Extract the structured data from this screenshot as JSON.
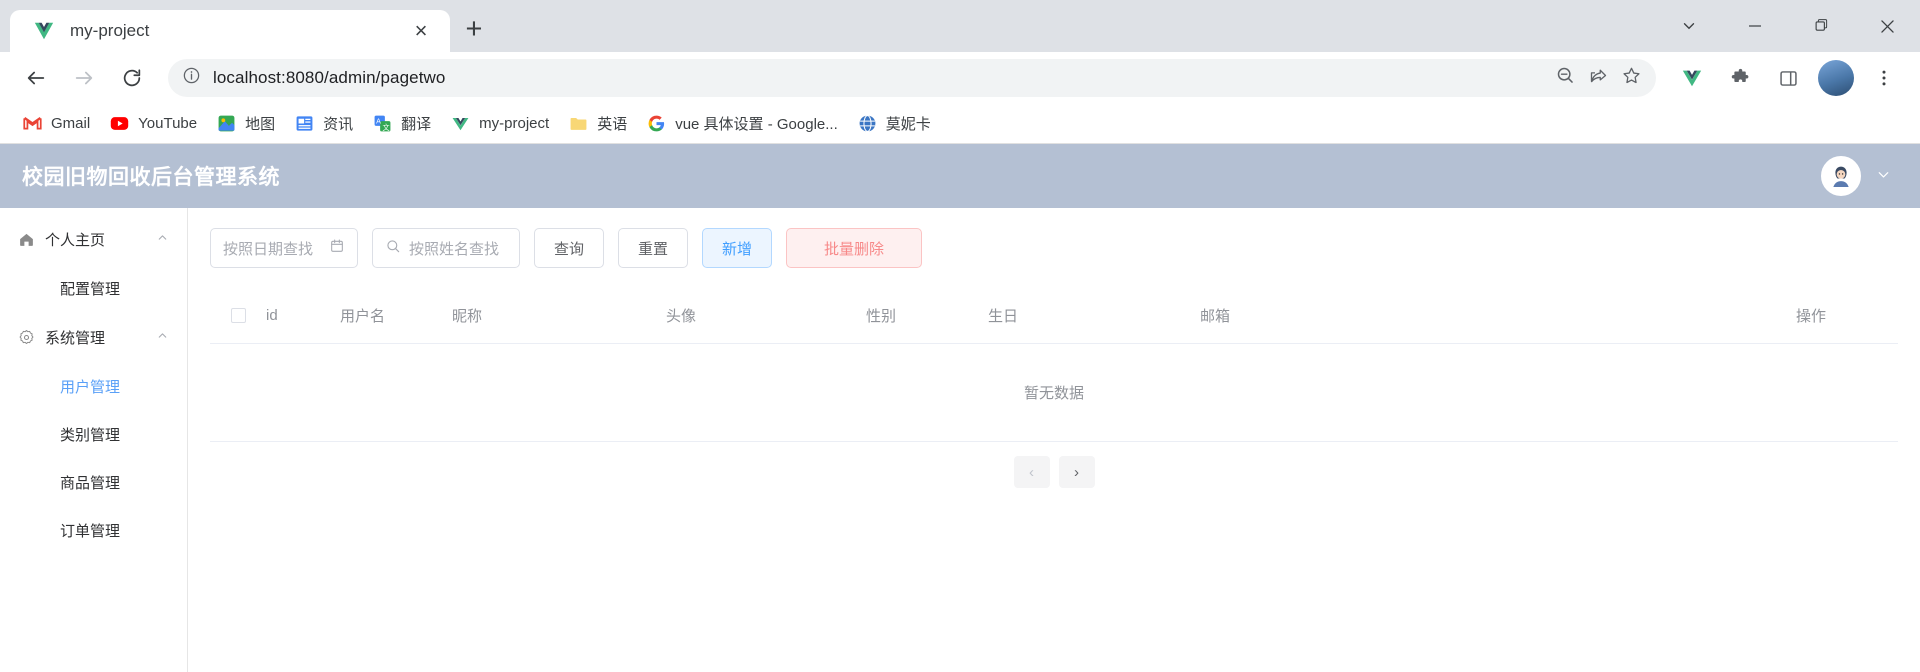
{
  "browser": {
    "tab": {
      "title": "my-project",
      "favicon": "vue-logo-icon",
      "close": "×",
      "newtab": "+"
    },
    "window_controls": {
      "minimize": "–",
      "maximize": "▭",
      "close": "✕",
      "list_tabs": "⌄"
    },
    "nav": {
      "back": "←",
      "forward": "→",
      "reload": "⟳"
    },
    "omnibox": {
      "info_icon": "info-circle-icon",
      "url": "localhost:8080/admin/pagetwo",
      "host": "localhost",
      "path": ":8080/admin/pagetwo",
      "zoom_icon": "zoom-out-icon",
      "share_icon": "share-icon",
      "bookmark_icon": "star-icon",
      "extension_icon": "puzzle-icon",
      "sidepanel_icon": "side-panel-icon",
      "menu_icon": "three-dot-menu-icon"
    },
    "bookmarks": [
      {
        "label": "Gmail",
        "icon": "gmail-icon"
      },
      {
        "label": "YouTube",
        "icon": "youtube-icon"
      },
      {
        "label": "地图",
        "icon": "google-maps-icon"
      },
      {
        "label": "资讯",
        "icon": "google-news-icon"
      },
      {
        "label": "翻译",
        "icon": "google-translate-icon"
      },
      {
        "label": "my-project",
        "icon": "vue-logo-icon"
      },
      {
        "label": "英语",
        "icon": "folder-icon"
      },
      {
        "label": "vue 具体设置 - Google...",
        "icon": "google-icon"
      },
      {
        "label": "莫妮卡",
        "icon": "monica-globe-icon"
      }
    ]
  },
  "app": {
    "header": {
      "title": "校园旧物回收后台管理系统",
      "avatar": "user-avatar",
      "chevron": "⌄"
    },
    "sidebar": [
      {
        "label": "个人主页",
        "icon": "home-icon",
        "type": "parent",
        "caret": "⌃",
        "active": false
      },
      {
        "label": "配置管理",
        "type": "child",
        "active": false
      },
      {
        "label": "系统管理",
        "icon": "gear-icon",
        "type": "parent",
        "caret": "⌃",
        "active": false
      },
      {
        "label": "用户管理",
        "type": "child",
        "active": true
      },
      {
        "label": "类别管理",
        "type": "child",
        "active": false
      },
      {
        "label": "商品管理",
        "type": "child",
        "active": false
      },
      {
        "label": "订单管理",
        "type": "child",
        "active": false
      }
    ],
    "toolbar": {
      "date_placeholder": "按照日期查找",
      "date_value": "",
      "date_icon": "calendar-icon",
      "name_placeholder": "按照姓名查找",
      "name_value": "",
      "search_icon": "search-icon",
      "query_label": "查询",
      "reset_label": "重置",
      "add_label": "新增",
      "batch_delete_label": "批量删除"
    },
    "table": {
      "columns": [
        "id",
        "用户名",
        "昵称",
        "头像",
        "性别",
        "生日",
        "邮箱",
        "操作"
      ],
      "select_all_checkbox": "",
      "rows": [],
      "empty_text": "暂无数据"
    },
    "pagination": {
      "prev": "‹",
      "next": "›"
    }
  },
  "colors": {
    "app_header_bg": "#b4c0d3",
    "primary": "#409eff",
    "danger": "#f78989",
    "active_menu": "#5aa0f7"
  }
}
